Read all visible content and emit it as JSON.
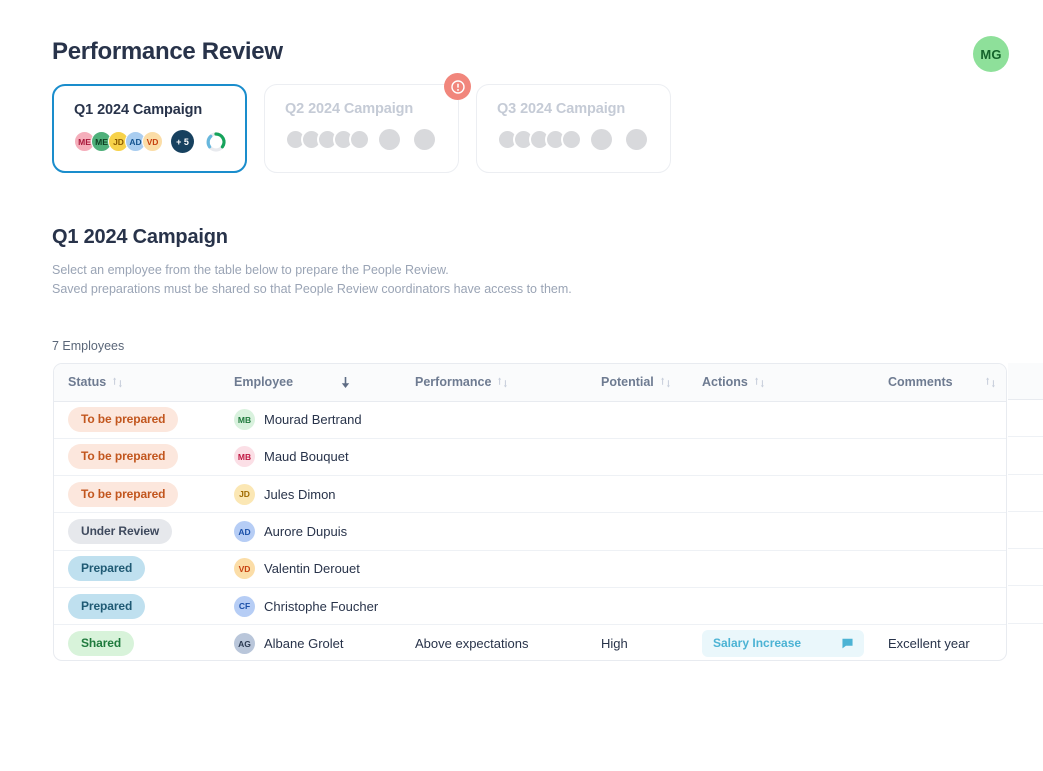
{
  "header": {
    "title": "Performance Review",
    "user_avatar": {
      "initials": "MG",
      "bg": "#8ee09a",
      "fg": "#14632b"
    }
  },
  "campaigns": [
    {
      "title": "Q1 2024 Campaign",
      "active": true,
      "avatars": [
        {
          "initials": "ME",
          "bg": "#f5aebb",
          "fg": "#a8173a"
        },
        {
          "initials": "ME",
          "bg": "#4fb07a",
          "fg": "#0d3f22"
        },
        {
          "initials": "JD",
          "bg": "#f7d24a",
          "fg": "#8a5a00"
        },
        {
          "initials": "AD",
          "bg": "#a9cdf0",
          "fg": "#13538f"
        },
        {
          "initials": "VD",
          "bg": "#fbdda7",
          "fg": "#c6400f"
        }
      ],
      "overflow_label": "+ 5",
      "progress_ring": {
        "green": "#16a35b",
        "blue": "#67b7dd",
        "track": "#e8eaee"
      }
    },
    {
      "title": "Q2 2024 Campaign",
      "active": false,
      "alert": true,
      "alert_icon": "alert-exclamation-icon"
    },
    {
      "title": "Q3 2024 Campaign",
      "active": false,
      "alert": false
    }
  ],
  "section": {
    "title": "Q1 2024 Campaign",
    "description_line1": "Select an employee from the table below to prepare the People Review.",
    "description_line2": "Saved preparations must be shared so that People Review coordinators have access to them.",
    "count_label": "7 Employees"
  },
  "table": {
    "columns": [
      {
        "label": "Status",
        "sort": "none"
      },
      {
        "label": "Employee",
        "sort": "desc"
      },
      {
        "label": "Performance",
        "sort": "none"
      },
      {
        "label": "Potential",
        "sort": "none"
      },
      {
        "label": "Actions",
        "sort": "none"
      },
      {
        "label": "Comments",
        "sort": "none"
      }
    ],
    "rows": [
      {
        "status": {
          "label": "To be prepared",
          "bg": "#fce7dd",
          "fg": "#c2561e"
        },
        "avatar": {
          "initials": "MB",
          "bg": "#d9f2de",
          "fg": "#1f7a3d"
        },
        "name": "Mourad Bertrand",
        "performance": "",
        "potential": "",
        "action": "",
        "comment": ""
      },
      {
        "status": {
          "label": "To be prepared",
          "bg": "#fce7dd",
          "fg": "#c2561e"
        },
        "avatar": {
          "initials": "MB",
          "bg": "#fbdfe6",
          "fg": "#c01843"
        },
        "name": "Maud Bouquet",
        "performance": "",
        "potential": "",
        "action": "",
        "comment": ""
      },
      {
        "status": {
          "label": "To be prepared",
          "bg": "#fce7dd",
          "fg": "#c2561e"
        },
        "avatar": {
          "initials": "JD",
          "bg": "#fbe7b4",
          "fg": "#a06a00"
        },
        "name": "Jules Dimon",
        "performance": "",
        "potential": "",
        "action": "",
        "comment": ""
      },
      {
        "status": {
          "label": "Under Review",
          "bg": "#e6e8ec",
          "fg": "#3f4a5e"
        },
        "avatar": {
          "initials": "AD",
          "bg": "#b6cdf5",
          "fg": "#1a4fa8"
        },
        "name": "Aurore Dupuis",
        "performance": "",
        "potential": "",
        "action": "",
        "comment": ""
      },
      {
        "status": {
          "label": "Prepared",
          "bg": "#bfe0ef",
          "fg": "#1f5a74"
        },
        "avatar": {
          "initials": "VD",
          "bg": "#fbdda7",
          "fg": "#c6400f"
        },
        "name": "Valentin Derouet",
        "performance": "",
        "potential": "",
        "action": "",
        "comment": ""
      },
      {
        "status": {
          "label": "Prepared",
          "bg": "#bfe0ef",
          "fg": "#1f5a74"
        },
        "avatar": {
          "initials": "CF",
          "bg": "#b6cdf5",
          "fg": "#1a4fa8"
        },
        "name": "Christophe Foucher",
        "performance": "",
        "potential": "",
        "action": "",
        "comment": ""
      },
      {
        "status": {
          "label": "Shared",
          "bg": "#d8f3da",
          "fg": "#1f7a3d"
        },
        "avatar": {
          "initials": "AG",
          "bg": "#b9c6da",
          "fg": "#2b3a52"
        },
        "name": "Albane Grolet",
        "performance": "Above expectations",
        "potential": "High",
        "action": "Salary Increase",
        "action_icon": "comment-flag-icon",
        "comment": "Excellent year"
      }
    ]
  }
}
